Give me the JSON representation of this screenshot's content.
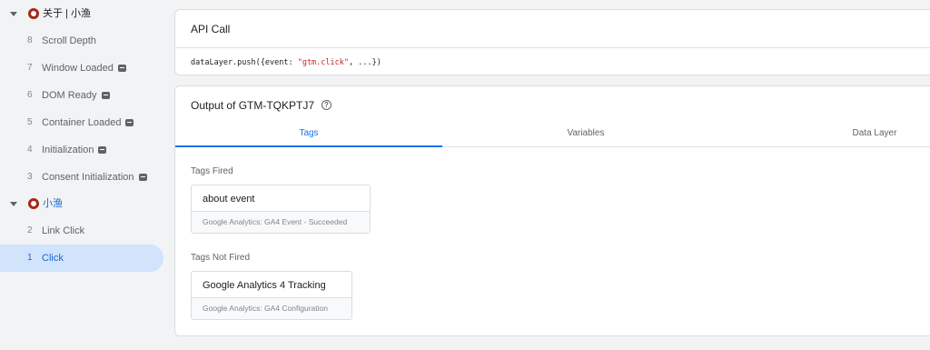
{
  "sidebar": {
    "group1": {
      "label": "关于 | 小渔"
    },
    "events1": [
      {
        "num": "8",
        "label": "Scroll Depth",
        "badge": false
      },
      {
        "num": "7",
        "label": "Window Loaded",
        "badge": true
      },
      {
        "num": "6",
        "label": "DOM Ready",
        "badge": true
      },
      {
        "num": "5",
        "label": "Container Loaded",
        "badge": true
      },
      {
        "num": "4",
        "label": "Initialization",
        "badge": true
      },
      {
        "num": "3",
        "label": "Consent Initialization",
        "badge": true
      }
    ],
    "group2": {
      "label": "小渔"
    },
    "events2": [
      {
        "num": "2",
        "label": "Link Click",
        "badge": false
      },
      {
        "num": "1",
        "label": "Click",
        "badge": false,
        "active": true
      }
    ]
  },
  "api_call": {
    "title": "API Call",
    "code_prefix": "dataLayer.push({event: ",
    "code_string": "\"gtm.click\"",
    "code_suffix": ", ...})"
  },
  "output": {
    "title": "Output of GTM-TQKPTJ7",
    "help_icon": "?",
    "tabs": [
      "Tags",
      "Variables",
      "Data Layer"
    ],
    "tags_fired_label": "Tags Fired",
    "tags_fired": [
      {
        "name": "about event",
        "detail": "Google Analytics: GA4 Event - Succeeded"
      }
    ],
    "tags_not_fired_label": "Tags Not Fired",
    "tags_not_fired": [
      {
        "name": "Google Analytics 4 Tracking",
        "detail": "Google Analytics: GA4 Configuration"
      }
    ]
  },
  "colors": {
    "accent": "#1a73e8",
    "active_bg": "#d2e3fc",
    "page_icon": "#a52714"
  }
}
